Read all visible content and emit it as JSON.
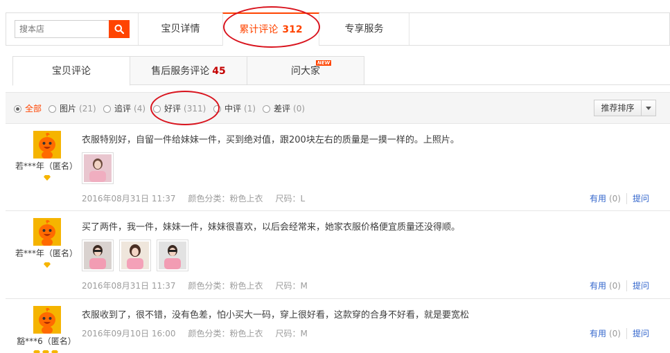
{
  "search": {
    "placeholder": "搜本店"
  },
  "top_tabs": [
    {
      "label": "宝贝详情"
    },
    {
      "label": "累计评论",
      "count": "312"
    },
    {
      "label": "专享服务"
    }
  ],
  "sub_tabs": [
    {
      "label": "宝贝评论"
    },
    {
      "label": "售后服务评论",
      "count": "45"
    },
    {
      "label": "问大家",
      "badge": "NEW"
    }
  ],
  "filters": [
    {
      "label": "全部",
      "count": ""
    },
    {
      "label": "图片",
      "count": "(21)"
    },
    {
      "label": "追评",
      "count": "(4)"
    },
    {
      "label": "好评",
      "count": "(311)"
    },
    {
      "label": "中评",
      "count": "(1)"
    },
    {
      "label": "差评",
      "count": "(0)"
    }
  ],
  "sort": {
    "label": "推荐排序"
  },
  "reviews": [
    {
      "user": "若***年（匿名）",
      "text": "衣服特别好，自留一件给妹妹一件，买到绝对值，跟200块左右的质量是一摸一样的。上照片。",
      "date": "2016年08月31日 11:37",
      "color": "颜色分类：粉色上衣",
      "size": "尺码：L",
      "useful_label": "有用",
      "useful_count": "(0)",
      "ask_label": "提问"
    },
    {
      "user": "若***年（匿名）",
      "text": "买了两件，我一件，妹妹一件，妹妹很喜欢，以后会经常来，她家衣服价格便宜质量还没得顺。",
      "date": "2016年08月31日 11:37",
      "color": "颜色分类：粉色上衣",
      "size": "尺码：M",
      "useful_label": "有用",
      "useful_count": "(0)",
      "ask_label": "提问"
    },
    {
      "user": "豁***6（匿名）",
      "text": "衣服收到了，很不错，没有色差，怕小买大一码，穿上很好看，这款穿的合身不好看，就是要宽松",
      "date": "2016年09月10日 16:00",
      "color": "颜色分类：粉色上衣",
      "size": "尺码：M",
      "useful_label": "有用",
      "useful_count": "(0)",
      "ask_label": "提问"
    }
  ],
  "colors": {
    "accent": "#ff4400",
    "annotation": "#d9141e",
    "link": "#3366cc",
    "count_red": "#c40000"
  }
}
